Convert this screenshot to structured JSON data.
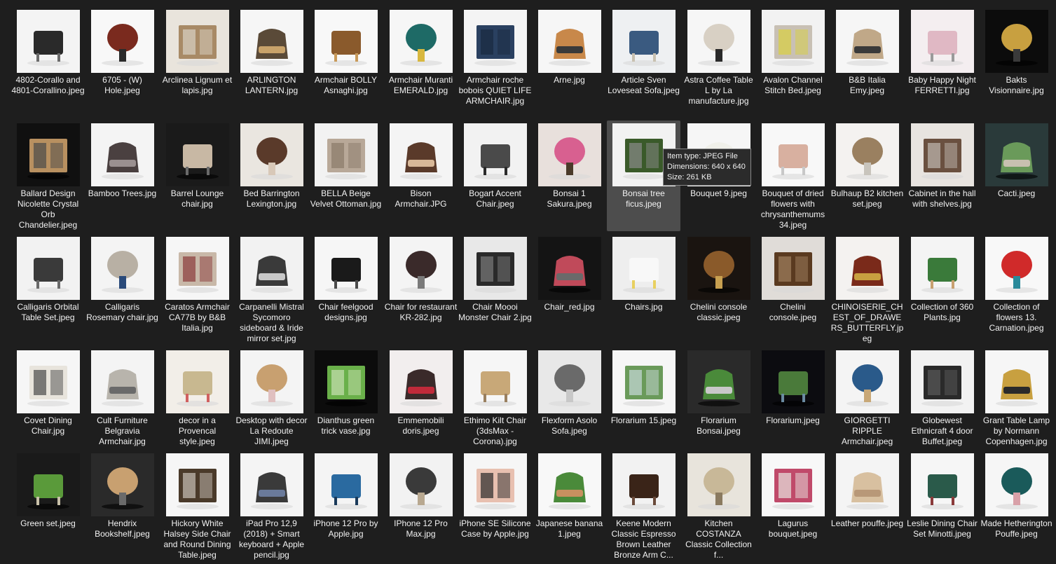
{
  "items": [
    {
      "label": "4802-Corallo and 4801-Corallino.jpeg",
      "bg": "#f4f4f4",
      "fg": "#2a2a2a",
      "accent": "#6b6b6b",
      "dark": false
    },
    {
      "label": "6705 - (W) Hole.jpeg",
      "bg": "#f8f8f8",
      "fg": "#7a2a1e",
      "accent": "#2b2b2b",
      "dark": false
    },
    {
      "label": "Arclinea Lignum et lapis.jpg",
      "bg": "#e9e4dc",
      "fg": "#a88a66",
      "accent": "#d9d2c4",
      "dark": false
    },
    {
      "label": "ARLINGTON LANTERN.jpg",
      "bg": "#f6f6f6",
      "fg": "#5a4a38",
      "accent": "#c8a26a",
      "dark": false
    },
    {
      "label": "Armchair BOLLY Asnaghi.jpg",
      "bg": "#f8f8f8",
      "fg": "#8a5a2c",
      "accent": "#c89a5a",
      "dark": false
    },
    {
      "label": "Armchair Muranti EMERALD.jpg",
      "bg": "#f6f6f6",
      "fg": "#1e6a66",
      "accent": "#d8b840",
      "dark": false
    },
    {
      "label": "Armchair roche bobois QUIET LIFE ARMCHAIR.jpg",
      "bg": "#f4f4f4",
      "fg": "#2a4060",
      "accent": "#1a2a40",
      "dark": false
    },
    {
      "label": "Arne.jpg",
      "bg": "#f6f6f6",
      "fg": "#c8884a",
      "accent": "#3a3a3a",
      "dark": false
    },
    {
      "label": "Article Sven Loveseat Sofa.jpeg",
      "bg": "#eef0f2",
      "fg": "#3a5a80",
      "accent": "#c8c0b0",
      "dark": false
    },
    {
      "label": "Astra Coffee Table L by La manufacture.jpg",
      "bg": "#f6f6f6",
      "fg": "#d8d0c4",
      "accent": "#2a2a2a",
      "dark": false
    },
    {
      "label": "Avalon Channel Stitch Bed.jpeg",
      "bg": "#f2f2f2",
      "fg": "#c8c0b4",
      "accent": "#d8d040",
      "dark": false
    },
    {
      "label": "B&B Italia Emy.jpeg",
      "bg": "#f6f6f6",
      "fg": "#c0a888",
      "accent": "#3a3a3a",
      "dark": false
    },
    {
      "label": "Baby Happy Night FERRETTI.jpg",
      "bg": "#f4eef0",
      "fg": "#e0b8c4",
      "accent": "#9a9a9a",
      "dark": false
    },
    {
      "label": "Bakts Visionnaire.jpg",
      "bg": "#0c0c0c",
      "fg": "#c8a040",
      "accent": "#3a3a3a",
      "dark": true
    },
    {
      "label": "Ballard Design Nicolette Crystal Orb Chandelier.jpeg",
      "bg": "#101010",
      "fg": "#b89060",
      "accent": "#4a4a4a",
      "dark": true
    },
    {
      "label": "Bamboo Trees.jpg",
      "bg": "#f4f4f4",
      "fg": "#4a4040",
      "accent": "#9a9090",
      "dark": false
    },
    {
      "label": "Barrel Lounge chair.jpg",
      "bg": "#1a1a1a",
      "fg": "#c8b8a4",
      "accent": "#6a6a6a",
      "dark": true
    },
    {
      "label": "Bed Barrington Lexington.jpg",
      "bg": "#eae6e0",
      "fg": "#5a3a2a",
      "accent": "#d8c8b8",
      "dark": false
    },
    {
      "label": "BELLA Beige Velvet Ottoman.jpg",
      "bg": "#f2f2f2",
      "fg": "#b8a898",
      "accent": "#8a7a6a",
      "dark": false
    },
    {
      "label": "Bison Armchair.JPG",
      "bg": "#f4f4f4",
      "fg": "#5a3a2a",
      "accent": "#d8b898",
      "dark": false
    },
    {
      "label": "Bogart Accent Chair.jpeg",
      "bg": "#f2f2f2",
      "fg": "#4a4a4a",
      "accent": "#2a2a2a",
      "dark": false
    },
    {
      "label": "Bonsai 1 Sakura.jpeg",
      "bg": "#e8e0dc",
      "fg": "#d86090",
      "accent": "#4a3a2a",
      "dark": false
    },
    {
      "label": "Bonsai tree ficus.jpeg",
      "bg": "#f2f2f2",
      "fg": "#3a5a2a",
      "accent": "#8a8a8a",
      "dark": false
    },
    {
      "label": "Bouquet 9.jpeg",
      "bg": "#f6f6f6",
      "fg": "#f0f0ea",
      "accent": "#6a8a50",
      "dark": false
    },
    {
      "label": "Bouquet of dried flowers with chrysanthemums 34.jpeg",
      "bg": "#f8f8f8",
      "fg": "#d8b0a0",
      "accent": "#c8c8c8",
      "dark": false
    },
    {
      "label": "Bulhaup B2 kitchen set.jpeg",
      "bg": "#f4f2f0",
      "fg": "#9a8060",
      "accent": "#c8c4bc",
      "dark": false
    },
    {
      "label": "Cabinet in the hall with shelves.jpg",
      "bg": "#e8e4e0",
      "fg": "#6a5040",
      "accent": "#c0b8b0",
      "dark": false
    },
    {
      "label": "Cacti.jpeg",
      "bg": "#2a3a3a",
      "fg": "#6a9a5a",
      "accent": "#c8c0b0",
      "dark": true
    },
    {
      "label": "Calligaris Orbital Table Set.jpeg",
      "bg": "#f2f2f2",
      "fg": "#3a3a3a",
      "accent": "#6a6a6a",
      "dark": false
    },
    {
      "label": "Calligaris Rosemary chair.jpg",
      "bg": "#f4f4f4",
      "fg": "#b8b0a4",
      "accent": "#2a4a7a",
      "dark": false
    },
    {
      "label": "Caratos Armchair CA77B by B&B Italia.jpg",
      "bg": "#f6f6f6",
      "fg": "#c8b8a8",
      "accent": "#8a3a3a",
      "dark": false
    },
    {
      "label": "Carpanelli Mistral Sycomoro sideboard & Iride mirror set.jpg",
      "bg": "#f2f2f2",
      "fg": "#3a3a3a",
      "accent": "#c8c8c8",
      "dark": false
    },
    {
      "label": "Chair feelgood designs.jpg",
      "bg": "#f6f6f6",
      "fg": "#1a1a1a",
      "accent": "#4a4a4a",
      "dark": false
    },
    {
      "label": "Chair for restaurant KR-282.jpg",
      "bg": "#f4f4f4",
      "fg": "#3a2a2a",
      "accent": "#7a7a7a",
      "dark": false
    },
    {
      "label": "Chair Moooi Monster Chair 2.jpg",
      "bg": "#e8e8e8",
      "fg": "#2a2a2a",
      "accent": "#7a7a7a",
      "dark": false
    },
    {
      "label": "Chair_red.jpg",
      "bg": "#141414",
      "fg": "#c04a5a",
      "accent": "#6a6a6a",
      "dark": true
    },
    {
      "label": "Chairs.jpg",
      "bg": "#eeeeee",
      "fg": "#f8f8f8",
      "accent": "#e8d060",
      "dark": false
    },
    {
      "label": "Chelini console classic.jpeg",
      "bg": "#1a1410",
      "fg": "#8a5a2a",
      "accent": "#c8a050",
      "dark": true
    },
    {
      "label": "Chelini console.jpeg",
      "bg": "#e0dcd8",
      "fg": "#5a3a20",
      "accent": "#a08060",
      "dark": false
    },
    {
      "label": "CHINOISERIE_CHEST_OF_DRAWERS_BUTTERFLY.jpeg",
      "bg": "#f4f2f0",
      "fg": "#7a2a1a",
      "accent": "#c8a040",
      "dark": false
    },
    {
      "label": "Collection of 360 Plants.jpg",
      "bg": "#f4f4f4",
      "fg": "#3a7a3a",
      "accent": "#c8a070",
      "dark": false
    },
    {
      "label": "Collection of flowers 13. Carnation.jpeg",
      "bg": "#f8f8f8",
      "fg": "#d02a2a",
      "accent": "#2a8a9a",
      "dark": false
    },
    {
      "label": "Covet Dining Chair.jpg",
      "bg": "#f6f6f6",
      "fg": "#e8e4dc",
      "accent": "#4a4a4a",
      "dark": false
    },
    {
      "label": "Cult Furniture Belgravia Armchair.jpg",
      "bg": "#f4f4f4",
      "fg": "#b8b4ac",
      "accent": "#6a6a6a",
      "dark": false
    },
    {
      "label": "decor in a Provencal style.jpeg",
      "bg": "#f2eee8",
      "fg": "#c8b890",
      "accent": "#d06060",
      "dark": false
    },
    {
      "label": "Desktop with decor La Redoute JIMI.jpeg",
      "bg": "#f4f4f4",
      "fg": "#c8a070",
      "accent": "#e0c0c0",
      "dark": false
    },
    {
      "label": "Dianthus green trick vase.jpg",
      "bg": "#0c0c0c",
      "fg": "#6ab04a",
      "accent": "#c8e0b0",
      "dark": true
    },
    {
      "label": "Emmemobili doris.jpeg",
      "bg": "#f2eeee",
      "fg": "#3a2a2a",
      "accent": "#c02a3a",
      "dark": false
    },
    {
      "label": "Ethimo Kilt Chair (3dsMax - Corona).jpg",
      "bg": "#f6f6f6",
      "fg": "#c8a878",
      "accent": "#9a8060",
      "dark": false
    },
    {
      "label": "Flexform Asolo Sofa.jpeg",
      "bg": "#e8e8e8",
      "fg": "#6a6a6a",
      "accent": "#c8c8c8",
      "dark": false
    },
    {
      "label": "Florarium 15.jpeg",
      "bg": "#f6f6f6",
      "fg": "#6a9a5a",
      "accent": "#c8d8d8",
      "dark": false
    },
    {
      "label": "Florarium Bonsai.jpeg",
      "bg": "#2a2a2a",
      "fg": "#4a8a3a",
      "accent": "#c8c8c8",
      "dark": true
    },
    {
      "label": "Florarium.jpeg",
      "bg": "#0c0c10",
      "fg": "#4a7a3a",
      "accent": "#6a8aa0",
      "dark": true
    },
    {
      "label": "GIORGETTI RIPPLE Armchair.jpeg",
      "bg": "#f4f4f4",
      "fg": "#2a5a8a",
      "accent": "#c8a878",
      "dark": false
    },
    {
      "label": "Globewest Ethnicraft 4 door Buffet.jpeg",
      "bg": "#f2f2f2",
      "fg": "#2a2a2a",
      "accent": "#5a5a5a",
      "dark": false
    },
    {
      "label": "Grant Table Lamp by Normann Copenhagen.jpg",
      "bg": "#f6f6f6",
      "fg": "#c8a040",
      "accent": "#2a2a2a",
      "dark": false
    },
    {
      "label": "Green set.jpeg",
      "bg": "#1a1a1a",
      "fg": "#5a9a3a",
      "accent": "#c8c0a8",
      "dark": true
    },
    {
      "label": "Hendrix Bookshelf.jpeg",
      "bg": "#2a2a2a",
      "fg": "#c8a070",
      "accent": "#6a6a6a",
      "dark": true
    },
    {
      "label": "Hickory White Halsey Side Chair and Round Dining Table.jpeg",
      "bg": "#f6f6f6",
      "fg": "#4a3a2a",
      "accent": "#c8c0b8",
      "dark": false
    },
    {
      "label": "iPad Pro 12,9 (2018) + Smart keyboard + Apple pencil.jpg",
      "bg": "#f4f4f4",
      "fg": "#3a3a3a",
      "accent": "#6a7a9a",
      "dark": false
    },
    {
      "label": "iPhone 12 Pro by Apple.jpg",
      "bg": "#f4f4f4",
      "fg": "#2a6aa0",
      "accent": "#1a3a5a",
      "dark": false
    },
    {
      "label": "IPhone 12 Pro Max.jpg",
      "bg": "#f2f2f2",
      "fg": "#3a3a3a",
      "accent": "#b8a890",
      "dark": false
    },
    {
      "label": "iPhone SE Silicone Case by Apple.jpg",
      "bg": "#f6f6f6",
      "fg": "#e8c0b0",
      "accent": "#2a2a2a",
      "dark": false
    },
    {
      "label": "Japanese banana 1.jpeg",
      "bg": "#f8f8f8",
      "fg": "#4a8a3a",
      "accent": "#c89060",
      "dark": false
    },
    {
      "label": "Keene Modern Classic Espresso Brown Leather Bronze Arm C...",
      "bg": "#f2f2f2",
      "fg": "#3a2418",
      "accent": "#6a4a3a",
      "dark": false
    },
    {
      "label": "Kitchen COSTANZA Classic Collection f...",
      "bg": "#e8e4dc",
      "fg": "#c8b898",
      "accent": "#8a7a60",
      "dark": false
    },
    {
      "label": "Lagurus bouquet.jpeg",
      "bg": "#f8f8f8",
      "fg": "#c04a6a",
      "accent": "#e8e4e0",
      "dark": false
    },
    {
      "label": "Leather pouffe.jpeg",
      "bg": "#f4f4f4",
      "fg": "#d8c0a0",
      "accent": "#b89878",
      "dark": false
    },
    {
      "label": "Leslie Dining Chair Set Minotti.jpeg",
      "bg": "#f6f6f6",
      "fg": "#2a5a4a",
      "accent": "#8a3a3a",
      "dark": false
    },
    {
      "label": "Made Hetherington Pouffe.jpeg",
      "bg": "#f6f6f6",
      "fg": "#1a5a5a",
      "accent": "#d8a0a8",
      "dark": false
    }
  ],
  "selected_index": 22,
  "tooltip": {
    "type": "Item type: JPEG File",
    "dimensions": "Dimensions: 640 x 640",
    "size": "Size: 261 KB"
  },
  "colors": {
    "background": "#1e1e1e",
    "text": "#f2f2f2",
    "selection": "#4d4d4d"
  }
}
